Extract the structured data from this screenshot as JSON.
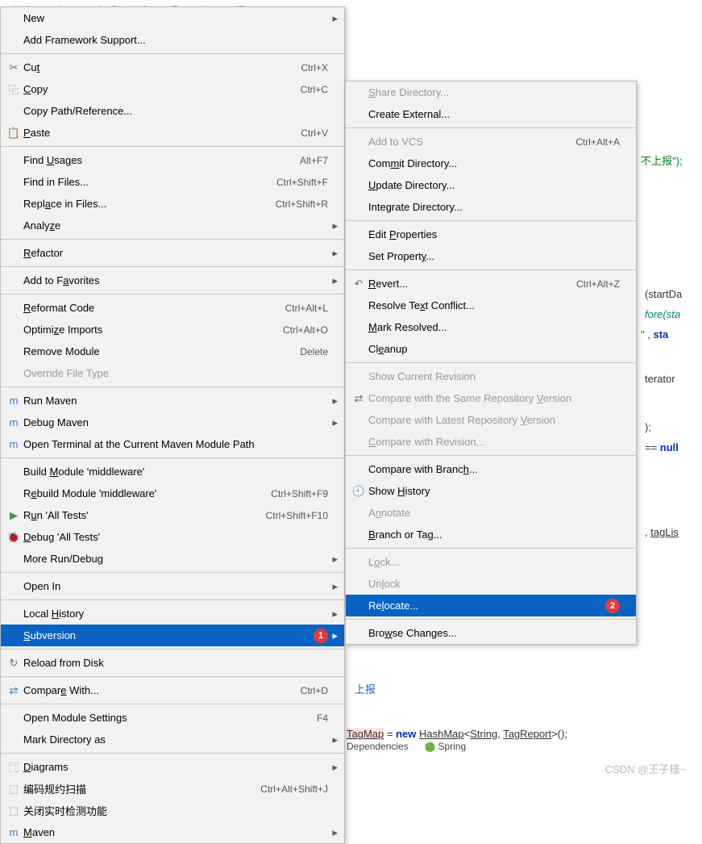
{
  "breadcrumb": [
    "middleware",
    "proxy",
    "DeviceControlProxy",
    "guardReport"
  ],
  "codeSnippets": {
    "line1": "不上报\");",
    "line2": "(startDa",
    "line3": "fore(sta",
    "line4": "\" , sta",
    "line5": "terator",
    "line6": ");",
    "line7": "== null",
    "line8": ", tagLis",
    "line9": "上报",
    "line10": "TagMap = new HashMap<String, TagReport>();"
  },
  "bottomTabs": {
    "dep": "Dependencies",
    "spring": "Spring"
  },
  "watermark": "CSDN @王子様~",
  "menu1": [
    {
      "type": "item",
      "label": "New",
      "arrow": true
    },
    {
      "type": "item",
      "label": "Add Framework Support..."
    },
    {
      "type": "sep"
    },
    {
      "type": "item",
      "icon": "✂",
      "label": "Cu<u>t</u>",
      "shortcut": "Ctrl+X"
    },
    {
      "type": "item",
      "icon": "⿻",
      "label": "<u>C</u>opy",
      "shortcut": "Ctrl+C"
    },
    {
      "type": "item",
      "label": "Copy Path/Reference..."
    },
    {
      "type": "item",
      "icon": "📋",
      "label": "<u>P</u>aste",
      "shortcut": "Ctrl+V"
    },
    {
      "type": "sep"
    },
    {
      "type": "item",
      "label": "Find <u>U</u>sages",
      "shortcut": "Alt+F7"
    },
    {
      "type": "item",
      "label": "Find in Files...",
      "shortcut": "Ctrl+Shift+F"
    },
    {
      "type": "item",
      "label": "Repl<u>a</u>ce in Files...",
      "shortcut": "Ctrl+Shift+R"
    },
    {
      "type": "item",
      "label": "Analy<u>z</u>e",
      "arrow": true
    },
    {
      "type": "sep"
    },
    {
      "type": "item",
      "label": "<u>R</u>efactor",
      "arrow": true
    },
    {
      "type": "sep"
    },
    {
      "type": "item",
      "label": "Add to F<u>a</u>vorites",
      "arrow": true
    },
    {
      "type": "sep"
    },
    {
      "type": "item",
      "label": "<u>R</u>eformat Code",
      "shortcut": "Ctrl+Alt+L"
    },
    {
      "type": "item",
      "label": "Optimi<u>z</u>e Imports",
      "shortcut": "Ctrl+Alt+O"
    },
    {
      "type": "item",
      "label": "Remove Module",
      "shortcut": "Delete"
    },
    {
      "type": "item",
      "label": "Override File Type",
      "disabled": true
    },
    {
      "type": "sep"
    },
    {
      "type": "item",
      "icon": "m",
      "iconColor": "#3a7ad6",
      "label": "Run Maven",
      "arrow": true
    },
    {
      "type": "item",
      "icon": "m",
      "iconColor": "#3a7ad6",
      "label": "Debug Maven",
      "arrow": true
    },
    {
      "type": "item",
      "icon": "m",
      "iconColor": "#3a7ad6",
      "label": "Open Terminal at the Current Maven Module Path"
    },
    {
      "type": "sep"
    },
    {
      "type": "item",
      "label": "Build <u>M</u>odule 'middleware'"
    },
    {
      "type": "item",
      "label": "R<u>e</u>build Module 'middleware'",
      "shortcut": "Ctrl+Shift+F9"
    },
    {
      "type": "item",
      "icon": "▶",
      "iconColor": "#3b9e3b",
      "label": "R<u>u</u>n 'All Tests'",
      "shortcut": "Ctrl+Shift+F10"
    },
    {
      "type": "item",
      "icon": "🐞",
      "iconColor": "#3b9e3b",
      "label": "<u>D</u>ebug 'All Tests'"
    },
    {
      "type": "item",
      "label": "More Run/Debug",
      "arrow": true
    },
    {
      "type": "sep"
    },
    {
      "type": "item",
      "label": "Open In",
      "arrow": true
    },
    {
      "type": "sep"
    },
    {
      "type": "item",
      "label": "Local <u>H</u>istory",
      "arrow": true
    },
    {
      "type": "item",
      "label": "<u>S</u>ubversion",
      "arrow": true,
      "selected": true,
      "badge": "1"
    },
    {
      "type": "sep"
    },
    {
      "type": "item",
      "icon": "↻",
      "label": "Reload from Disk"
    },
    {
      "type": "sep"
    },
    {
      "type": "item",
      "icon": "⇄",
      "iconColor": "#2f7dd1",
      "label": "Compar<u>e</u> With...",
      "shortcut": "Ctrl+D"
    },
    {
      "type": "sep"
    },
    {
      "type": "item",
      "label": "Open Module Settings",
      "shortcut": "F4"
    },
    {
      "type": "item",
      "label": "Mark Directory as",
      "arrow": true
    },
    {
      "type": "sep"
    },
    {
      "type": "item",
      "icon": "⿹",
      "iconColor": "#4a90d9",
      "label": "<u>D</u>iagrams",
      "arrow": true
    },
    {
      "type": "item",
      "icon": "⬚",
      "iconColor": "#4a90d9",
      "label": "编码规约扫描",
      "shortcut": "Ctrl+Alt+Shift+J"
    },
    {
      "type": "item",
      "icon": "⬚",
      "iconColor": "#4a90d9",
      "label": "关闭实时检测功能"
    },
    {
      "type": "item",
      "icon": "m",
      "iconColor": "#3a7ad6",
      "label": "<u>M</u>aven",
      "arrow": true
    }
  ],
  "menu2": [
    {
      "type": "item",
      "label": "<u>S</u>hare Directory...",
      "disabled": true
    },
    {
      "type": "item",
      "label": "Create External..."
    },
    {
      "type": "sep"
    },
    {
      "type": "item",
      "label": "Add to VCS",
      "shortcut": "Ctrl+Alt+A",
      "disabled": true
    },
    {
      "type": "item",
      "label": "Com<u>m</u>it Directory..."
    },
    {
      "type": "item",
      "label": "<u>U</u>pdate Directory..."
    },
    {
      "type": "item",
      "label": "Inte<u>g</u>rate Directory..."
    },
    {
      "type": "sep"
    },
    {
      "type": "item",
      "label": "Edit <u>P</u>roperties"
    },
    {
      "type": "item",
      "label": "Set Propert<u>y</u>..."
    },
    {
      "type": "sep"
    },
    {
      "type": "item",
      "icon": "↶",
      "label": "<u>R</u>evert...",
      "shortcut": "Ctrl+Alt+Z"
    },
    {
      "type": "item",
      "label": "Resolve Te<u>x</u>t Conflict..."
    },
    {
      "type": "item",
      "label": "<u>M</u>ark Resolved..."
    },
    {
      "type": "item",
      "label": "Cl<u>e</u>anup"
    },
    {
      "type": "sep"
    },
    {
      "type": "item",
      "label": "Show Current Revision",
      "disabled": true
    },
    {
      "type": "item",
      "icon": "⇄",
      "label": "Compare with the Same Repository <u>V</u>ersion",
      "disabled": true
    },
    {
      "type": "item",
      "label": "Compare with Latest Repository <u>V</u>ersion",
      "disabled": true
    },
    {
      "type": "item",
      "label": "<u>C</u>ompare with Revision...",
      "disabled": true
    },
    {
      "type": "sep"
    },
    {
      "type": "item",
      "label": "Compare with Branc<u>h</u>..."
    },
    {
      "type": "item",
      "icon": "🕘",
      "label": "Show <u>H</u>istory"
    },
    {
      "type": "item",
      "label": "A<u>n</u>notate",
      "disabled": true
    },
    {
      "type": "item",
      "label": "<u>B</u>ranch or Tag..."
    },
    {
      "type": "sep"
    },
    {
      "type": "item",
      "label": "L<u>o</u>ck...",
      "disabled": true
    },
    {
      "type": "item",
      "label": "Un<u>l</u>ock",
      "disabled": true
    },
    {
      "type": "item",
      "label": "Re<u>l</u>ocate...",
      "selected": true,
      "badge": "2"
    },
    {
      "type": "sep"
    },
    {
      "type": "item",
      "label": "Bro<u>w</u>se Changes..."
    }
  ]
}
